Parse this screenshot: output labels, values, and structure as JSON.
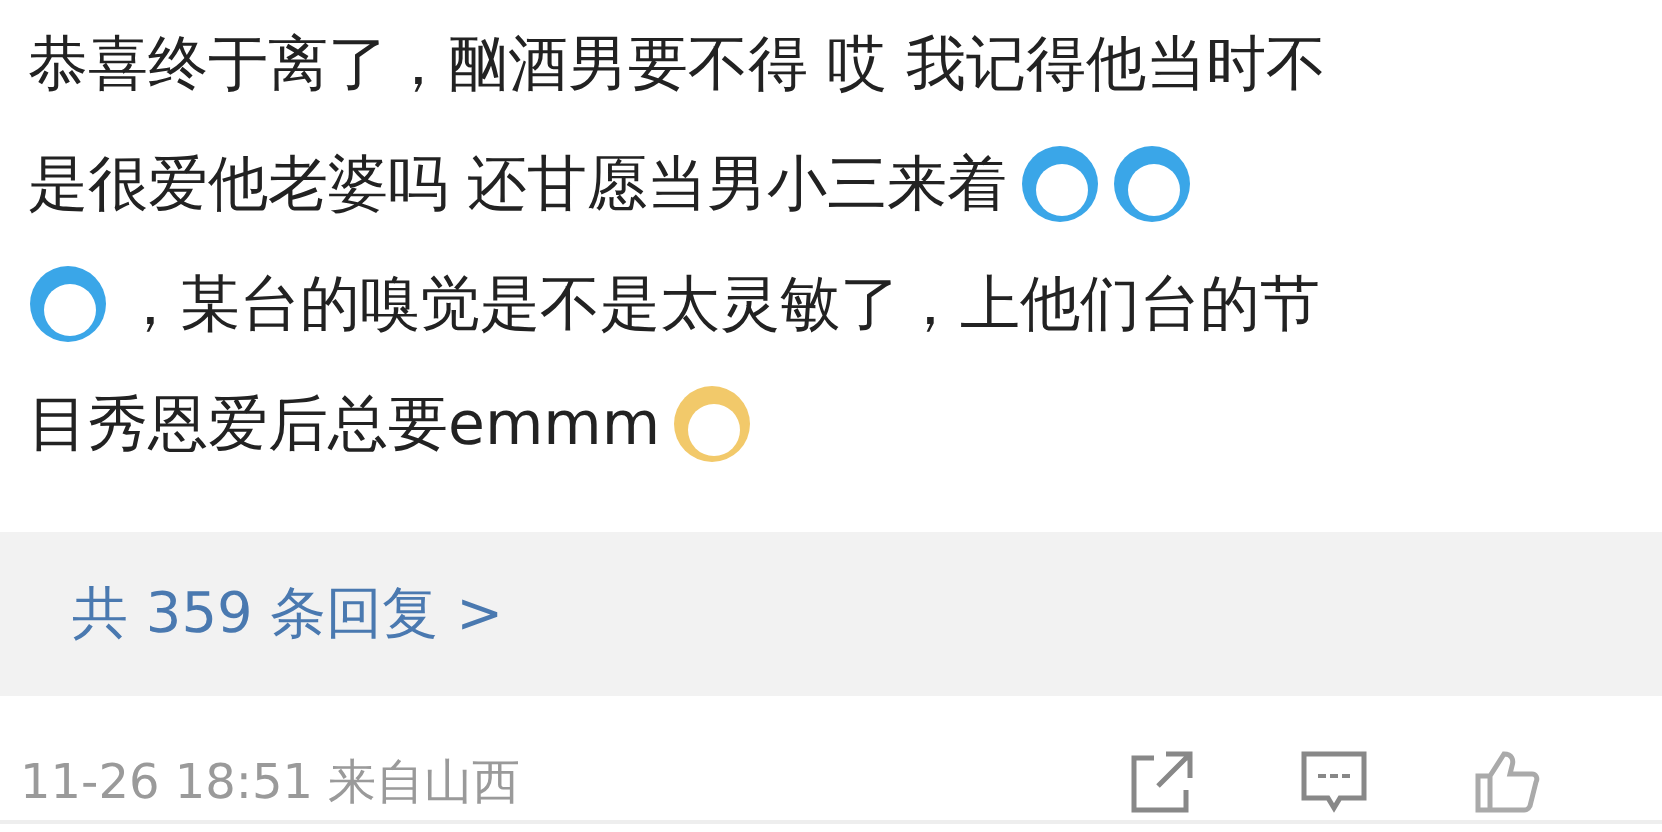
{
  "comment": {
    "lines": [
      [
        {
          "kind": "text",
          "text": "恭喜终于离了，酗酒男要不得 哎 我记得他当时不"
        }
      ],
      [
        {
          "kind": "text",
          "text": "是很爱他老婆吗 还甘愿当男小三来着"
        },
        {
          "kind": "emoji",
          "color": "#3aa6e8"
        },
        {
          "kind": "emoji",
          "color": "#3aa6e8"
        }
      ],
      [
        {
          "kind": "emoji",
          "color": "#3aa6e8"
        },
        {
          "kind": "text",
          "text": "，某台的嗅觉是不是太灵敏了，上他们台的节"
        }
      ],
      [
        {
          "kind": "text",
          "text": "目秀恩爱后总要emmm"
        },
        {
          "kind": "emoji",
          "color": "#f2c96a"
        }
      ]
    ]
  },
  "replies": {
    "label": "共 359 条回复 >"
  },
  "footer": {
    "meta": "11-26 18:51 来自山西"
  }
}
